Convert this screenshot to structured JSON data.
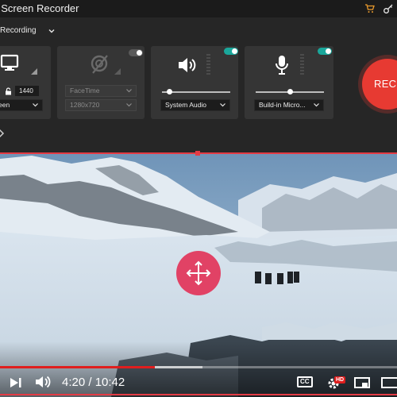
{
  "app": {
    "title": "Aiseesoft Screen Recorder",
    "title_visible": "t Screen Recorder",
    "mode_label": "Recording"
  },
  "screen_panel": {
    "height_value": "1440",
    "source_select": "Full Screen",
    "source_select_visible": "een"
  },
  "webcam_panel": {
    "enabled": false,
    "camera_select": "FaceTime",
    "resolution_select": "1280x720"
  },
  "audio_panel": {
    "enabled": true,
    "source_select": "System Audio",
    "volume": 0.1
  },
  "mic_panel": {
    "enabled": true,
    "source_select": "Build-in Micro...",
    "volume": 0.5
  },
  "record_button": {
    "label": "REC"
  },
  "player": {
    "time": "4:20 / 10:42",
    "progress": 0.39,
    "hd_badge": "HD",
    "cc_label": "CC"
  },
  "colors": {
    "accent_red": "#e33b44",
    "toggle_on": "#1aa79b",
    "rec_red": "#e73a32",
    "move_pink": "#e23a5e"
  },
  "icons": [
    "cart-icon",
    "key-icon",
    "chevron-down-icon",
    "monitor-icon",
    "lock-icon",
    "webcam-off-icon",
    "speaker-icon",
    "microphone-icon",
    "settings-icon",
    "move-icon",
    "play-next-icon",
    "volume-icon",
    "cc-icon",
    "settings-gear-icon",
    "miniplayer-icon",
    "theater-icon"
  ]
}
